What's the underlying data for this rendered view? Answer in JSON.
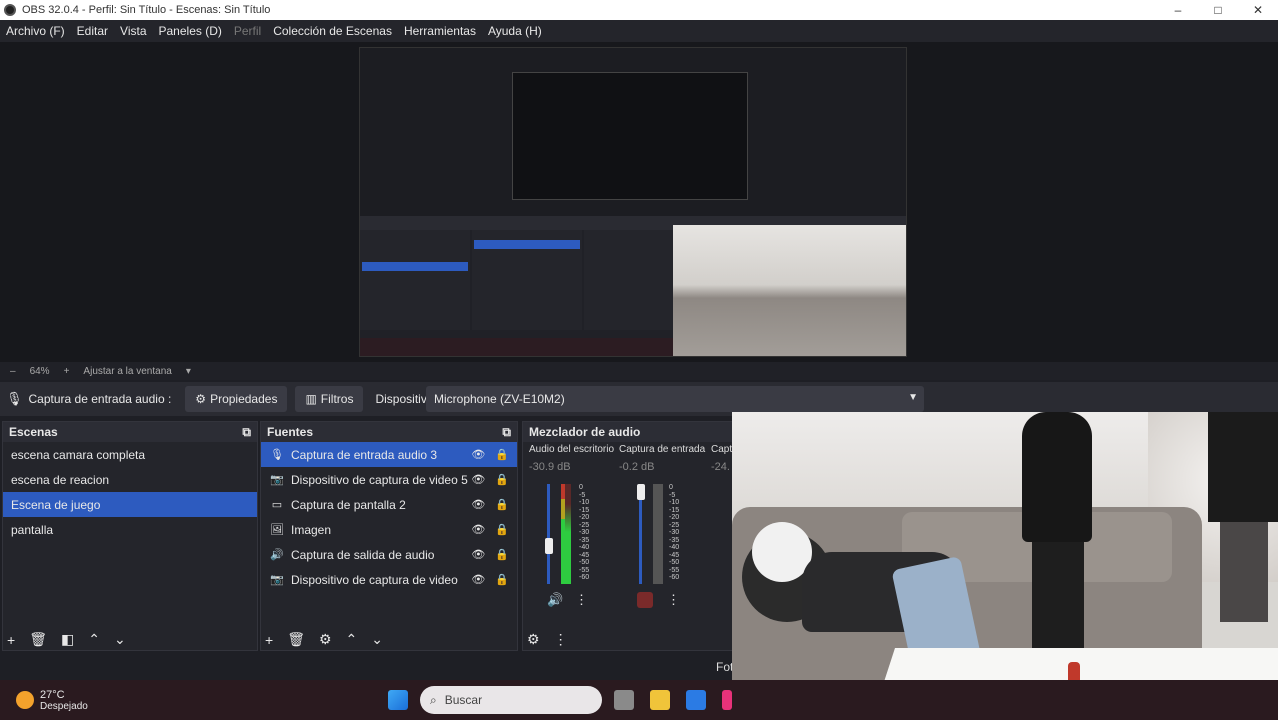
{
  "window": {
    "title": "OBS 32.0.4 - Perfil: Sin Título - Escenas: Sin Título",
    "minimize": "–",
    "maximize": "□",
    "close": "✕"
  },
  "menu": [
    "Archivo (F)",
    "Editar",
    "Vista",
    "Paneles (D)",
    "Perfil",
    "Colección de Escenas",
    "Herramientas",
    "Ayuda (H)"
  ],
  "zoom": {
    "minus": "–",
    "value": "64%",
    "plus": "+",
    "fit": "Ajustar a la ventana",
    "arrow": "▾"
  },
  "propbar": {
    "source": "Captura de entrada audio :",
    "properties": "Propiedades",
    "filters": "Filtros",
    "device_label": "Dispositivo",
    "device_value": "Microphone (ZV-E10M2)"
  },
  "scenes": {
    "title": "Escenas",
    "items": [
      "escena camara completa",
      "escena de reacion",
      "Escena de juego",
      "pantalla"
    ],
    "selected": 2
  },
  "sources": {
    "title": "Fuentes",
    "items": [
      {
        "label": "Captura de entrada audio 3",
        "icon": "mic-icon"
      },
      {
        "label": "Dispositivo de captura de video 5",
        "icon": "camera-icon"
      },
      {
        "label": "Captura de pantalla 2",
        "icon": "monitor-icon"
      },
      {
        "label": "Imagen",
        "icon": "image-icon"
      },
      {
        "label": "Captura de salida de audio",
        "icon": "speaker-icon"
      },
      {
        "label": "Dispositivo de captura de video",
        "icon": "camera-icon"
      }
    ],
    "selected": 0
  },
  "mixer": {
    "title": "Mezclador de audio",
    "channels": [
      {
        "name": "Audio del escritorio",
        "db": "-30.9 dB"
      },
      {
        "name": "Captura de entrada",
        "db": "-0.2 dB"
      },
      {
        "name": "Capt",
        "db": "-24."
      }
    ],
    "ticks": [
      "0",
      "-5",
      "-10",
      "-15",
      "-20",
      "-25",
      "-30",
      "-35",
      "-40",
      "-45",
      "-50",
      "-55",
      "-60"
    ]
  },
  "footer_text": "Fot",
  "taskbar": {
    "temp": "27°C",
    "condition": "Despejado",
    "search": "Buscar"
  },
  "colors": {
    "accent": "#2d5bbf",
    "panel": "#24252b",
    "taskbar": "#2a1a1f"
  }
}
